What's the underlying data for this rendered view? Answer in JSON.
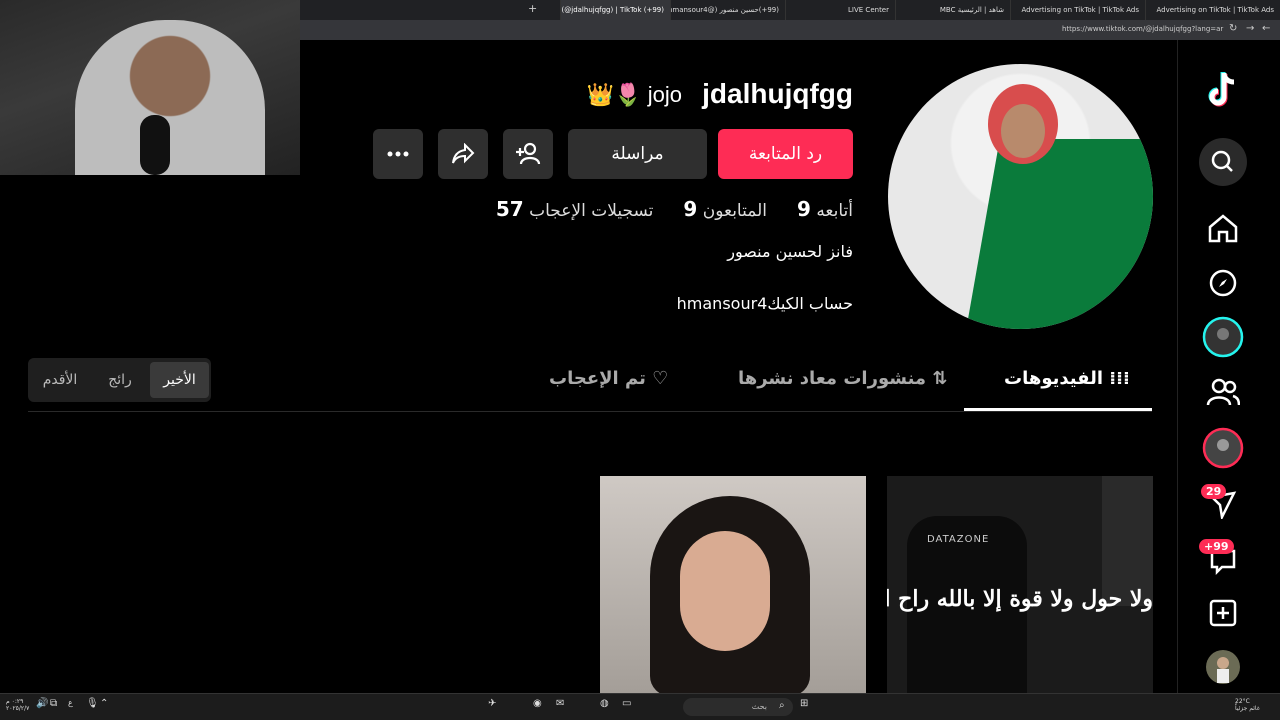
{
  "browser": {
    "tabs": [
      {
        "label": "Advertising on TikTok | TikTok Ads",
        "active": false
      },
      {
        "label": "Advertising on TikTok | TikTok Ads",
        "active": false
      },
      {
        "label": "شاهد | الرئيسية MBC",
        "active": false
      },
      {
        "label": "LIVE Center",
        "active": false
      },
      {
        "label": "(99+)حسين منصور (@hmansour4)",
        "active": false
      },
      {
        "label": "(99+) jojo (@jdalhujqfgg) | TikTok",
        "active": true
      }
    ],
    "new_tab": "+",
    "url": "https://www.tiktok.com/@jdalhujqfgg?lang=ar"
  },
  "sidebar": {
    "logo": "tiktok-logo",
    "badges": {
      "activity": "29",
      "inbox": "+99"
    }
  },
  "profile": {
    "username": "jdalhujqfgg",
    "nickname": "jojo",
    "nickname_emojis": "👑🌷",
    "follow_back_label": "رد المتابعة",
    "message_label": "مراسلة",
    "stats": [
      {
        "num": "9",
        "label": "أتابعه"
      },
      {
        "num": "9",
        "label": "المتابعون"
      },
      {
        "num": "57",
        "label": "تسجيلات الإعجاب"
      }
    ],
    "bio_line1": "فانز لحسين منصور",
    "bio_line2": "حساب الكيكhmansour4"
  },
  "content_tabs": [
    {
      "label": "الفيديوهات",
      "active": true
    },
    {
      "label": "منشورات معاد نشرها",
      "active": false
    },
    {
      "label": "تم الإعجاب",
      "active": false
    }
  ],
  "sort": {
    "options": [
      "الأخير",
      "رائج",
      "الأقدم"
    ],
    "selected": "الأخير"
  },
  "videos": [
    {
      "caption": "ولا حول ولا قوة إلا بالله راح الـ",
      "chair_text": "DATAZONE"
    },
    {
      "caption": ""
    }
  ],
  "taskbar": {
    "search_label": "بحث",
    "weather_temp": "22°C",
    "weather_desc": "غائم جزئياً",
    "clock_time": "٠:٢٩ م",
    "clock_date": "٢٠٢٥/٢/٧",
    "lang": "ع"
  }
}
